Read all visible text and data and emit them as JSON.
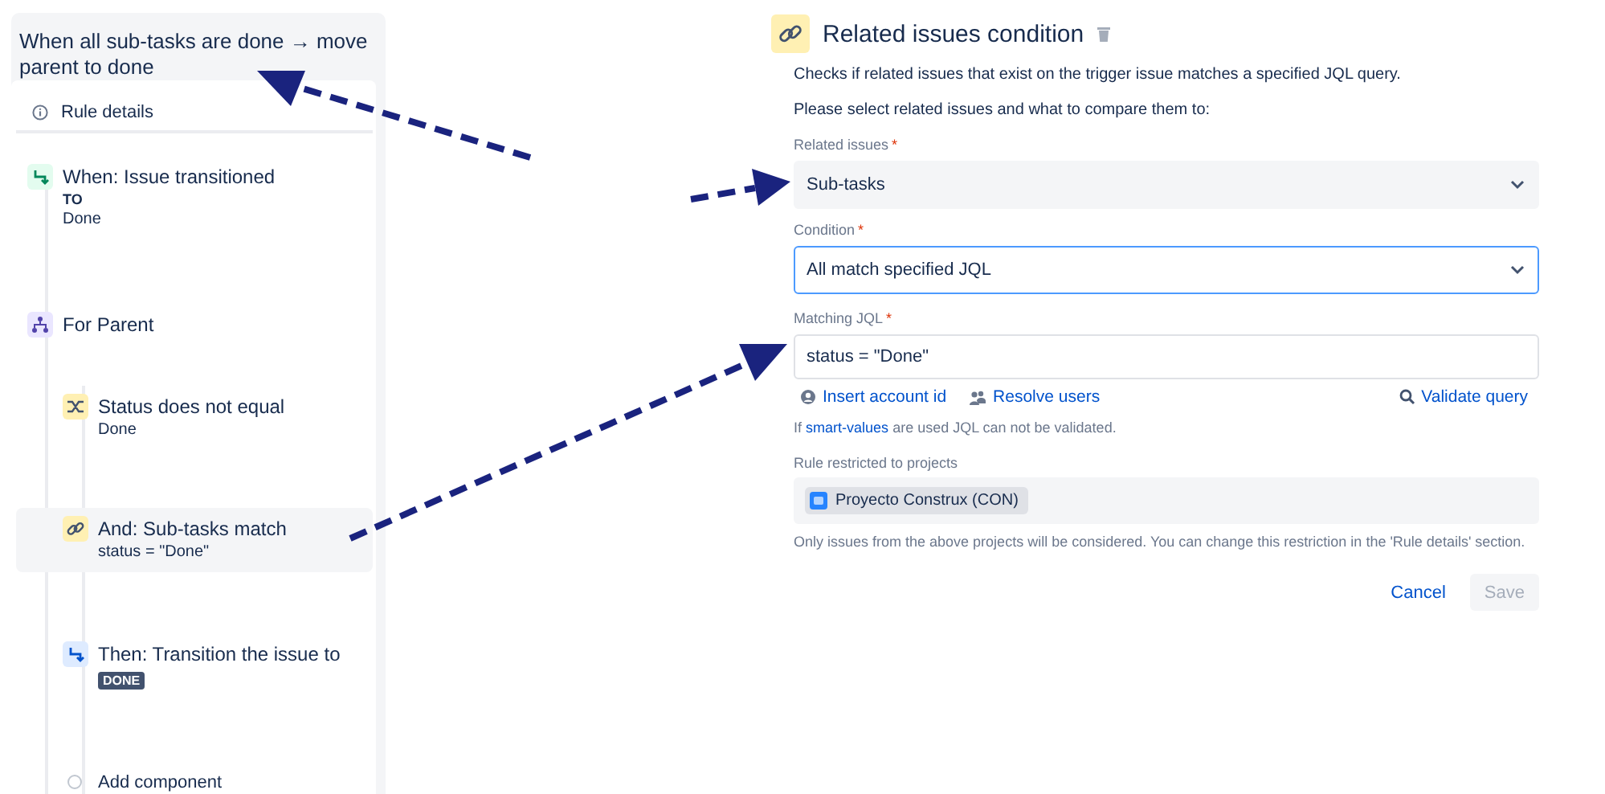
{
  "rule": {
    "title": "When all sub-tasks are done → move parent to done",
    "details_link": "Rule details",
    "steps": [
      {
        "kind": "trigger",
        "title": "When: Issue transitioned",
        "sub_label": "TO",
        "detail": "Done",
        "selected": false
      },
      {
        "kind": "branch",
        "title": "For Parent",
        "selected": false,
        "children": [
          {
            "kind": "condition",
            "title": "Status does not equal",
            "detail": "Done",
            "selected": false
          },
          {
            "kind": "related",
            "title": "And: Sub-tasks match",
            "detail": "status = \"Done\"",
            "selected": true
          },
          {
            "kind": "action",
            "title": "Then: Transition the issue to",
            "lozenge": "DONE",
            "selected": false
          },
          {
            "kind": "add",
            "title": "Add component",
            "selected": false
          }
        ]
      }
    ]
  },
  "editor": {
    "title": "Related issues condition",
    "description": "Checks if related issues that exist on the trigger issue matches a specified JQL query.",
    "prompt": "Please select related issues and what to compare them to:",
    "fields": [
      {
        "kind": "select",
        "label": "Related issues",
        "required_mark": "*",
        "value": "Sub-tasks",
        "focused": false
      },
      {
        "kind": "select",
        "label": "Condition",
        "required_mark": "*",
        "value": "All match specified JQL",
        "focused": true
      },
      {
        "kind": "text",
        "label": "Matching JQL",
        "required_mark": "*",
        "value": "status = \"Done\"",
        "focused": false
      }
    ],
    "jql_links": [
      {
        "kind": "account",
        "label": "Insert account id"
      },
      {
        "kind": "users",
        "label": "Resolve users"
      },
      {
        "kind": "validate",
        "label": "Validate query"
      }
    ],
    "hint": {
      "before": "If",
      "link": "smart-values",
      "after": "are used JQL can not be validated."
    },
    "projects_label": "Rule restricted to projects",
    "projects": [
      "Proyecto Construx (CON)"
    ],
    "projects_note": "Only issues from the above projects will be considered. You can change this restriction in the 'Rule details' section.",
    "buttons": [
      {
        "kind": "link",
        "label": "Cancel",
        "disabled": false
      },
      {
        "kind": "primary",
        "label": "Save",
        "disabled": true
      }
    ]
  }
}
